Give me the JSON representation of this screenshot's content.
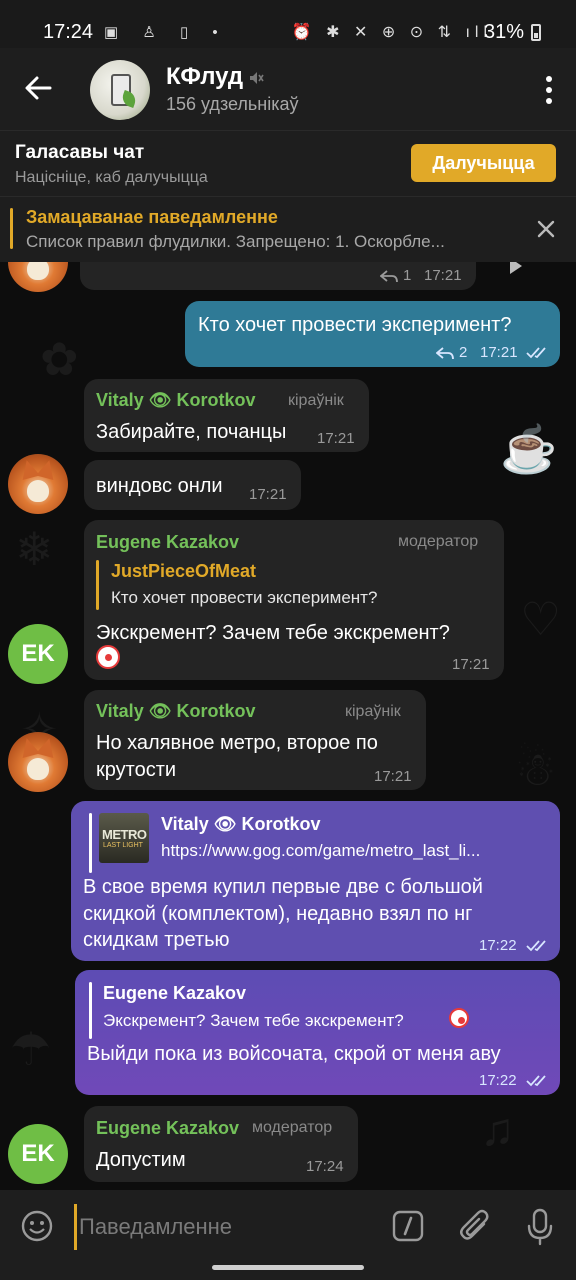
{
  "status_bar": {
    "time": "17:24",
    "battery": "31%",
    "left_icons": "▣ ♙ ▯ •",
    "right_icons": "⏰ ✱ ✕ ⊕ ⊙ ⇅ ıll"
  },
  "header": {
    "title": "КФлуд",
    "subtitle": "156 удзельнікаў"
  },
  "voice_chat": {
    "title": "Галасавы чат",
    "subtitle": "Націсніце, каб далучыцца",
    "join_label": "Далучыцца"
  },
  "pinned": {
    "title": "Замацаванае паведамленне",
    "text": "Список правил флудилки.  Запрещено: 1. Оскорбле..."
  },
  "messages": {
    "m0": {
      "replies": "1",
      "time": "17:21"
    },
    "m1": {
      "text": "Кто хочет провести эксперимент?",
      "replies": "2",
      "time": "17:21"
    },
    "m2": {
      "sender": "Vitaly 👁 Korotkov",
      "role": "кіраўнік",
      "text": "Забирайте, почанцы",
      "time": "17:21"
    },
    "m3": {
      "text": "виндовс онли",
      "time": "17:21"
    },
    "m4": {
      "sender": "Eugene Kazakov",
      "role": "модератор",
      "quote_name": "JustPieceOfMeat",
      "quote_text": "Кто хочет провести эксперимент?",
      "text": "Экскремент? Зачем тебе экскремент?",
      "time": "17:21"
    },
    "m5": {
      "sender": "Vitaly 👁 Korotkov",
      "role": "кіраўнік",
      "text_line1": "Но халявное метро, второе по",
      "text_line2": "крутости",
      "time": "17:21"
    },
    "m6": {
      "quote_name": "Vitaly 👁 Korotkov",
      "quote_text": "https://www.gog.com/game/metro_last_li...",
      "thumb_title": "METRO",
      "thumb_sub": "LAST LIGHT",
      "text_line1": "В свое время купил первые две с большой",
      "text_line2": "скидкой (комплектом), недавно взял по нг",
      "text_line3": "скидкам третью",
      "time": "17:22"
    },
    "m7": {
      "quote_name": "Eugene Kazakov",
      "quote_text": "Экскремент? Зачем тебе экскремент?",
      "text": "Выйди пока из войсочата, скрой от меня аву",
      "time": "17:22"
    },
    "m8": {
      "sender": "Eugene Kazakov",
      "role": "модератор",
      "text": "Допустим",
      "time": "17:24"
    }
  },
  "avatars": {
    "ek_initials": "EK"
  },
  "input": {
    "placeholder": "Паведамленне"
  },
  "colors": {
    "accent": "#e1a928",
    "sender_green": "#74c15a",
    "outgoing_teal": "#2f7a96",
    "outgoing_purple": "#5f4fb0",
    "incoming": "#242424"
  }
}
